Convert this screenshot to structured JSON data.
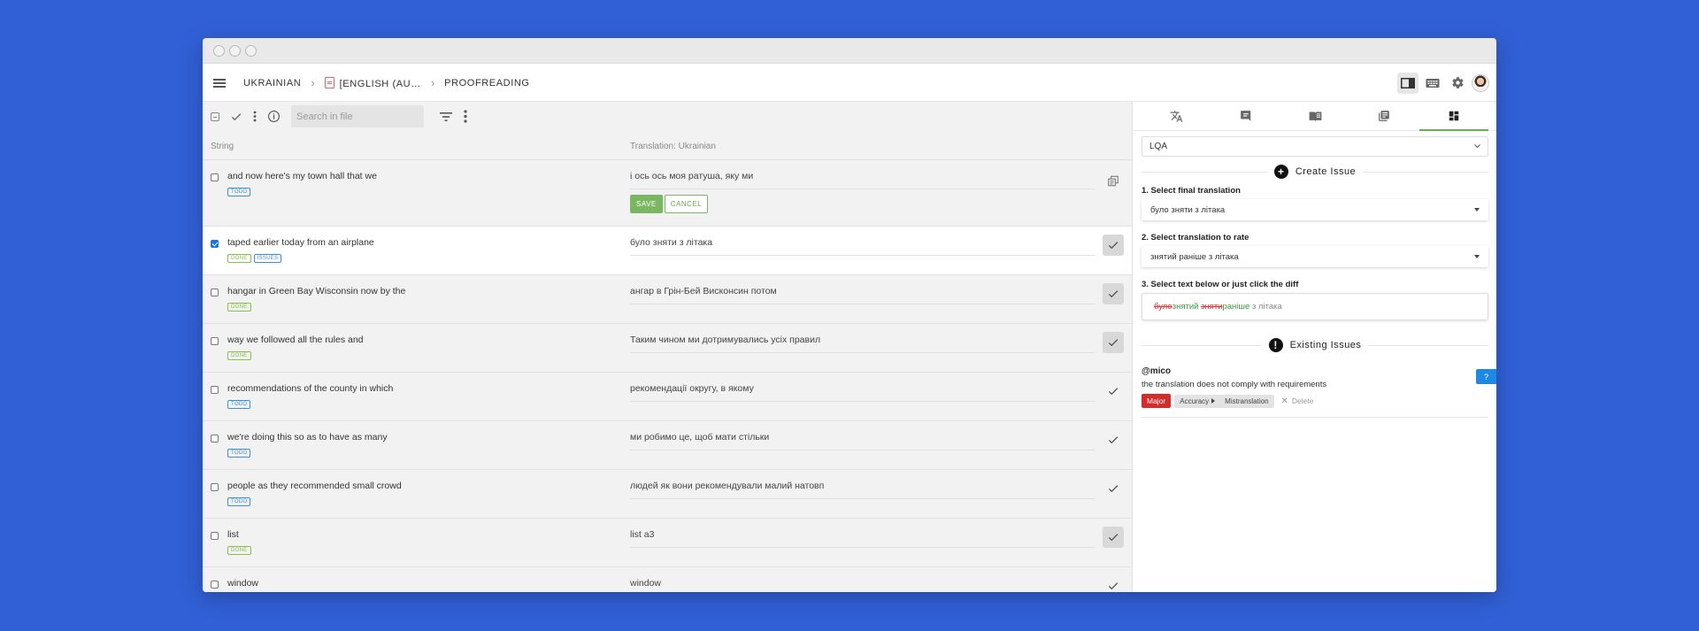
{
  "breadcrumb": {
    "project": "UKRAINIAN",
    "file": "[ENGLISH (AU…",
    "step": "PROOFREADING"
  },
  "toolbar": {
    "search_placeholder": "Search in file"
  },
  "columns": {
    "string": "String",
    "translation": "Translation: Ukrainian"
  },
  "rows": [
    {
      "source": "and now here's my town hall that we",
      "translation": "і ось ось моя ратуша, яку ми",
      "tags": [
        "TODO"
      ],
      "checked": false,
      "editing": true
    },
    {
      "source": "taped earlier today from an airplane",
      "translation": "було зняти з літака",
      "tags": [
        "DONE",
        "ISSUES"
      ],
      "checked": true,
      "approved": true
    },
    {
      "source": "hangar in Green Bay Wisconsin now by the",
      "translation": "ангар в Грін-Бей Висконсин потом",
      "tags": [
        "DONE"
      ],
      "checked": false,
      "approved": true
    },
    {
      "source": "way we followed all the rules and",
      "translation": "Таким чином ми дотримувались усіх правил",
      "tags": [
        "DONE"
      ],
      "checked": false,
      "approved": true
    },
    {
      "source": "recommendations of the county in which",
      "translation": "рекомендації округу, в якому",
      "tags": [
        "TODO"
      ],
      "checked": false,
      "approved": false
    },
    {
      "source": "we're doing this so as to have as many",
      "translation": "ми робимо це, щоб мати стільки",
      "tags": [
        "TODO"
      ],
      "checked": false,
      "approved": false
    },
    {
      "source": "people as they recommended small crowd",
      "translation": "людей як вони рекомендували малий натовп",
      "tags": [
        "TODO"
      ],
      "checked": false,
      "approved": false
    },
    {
      "source": "list",
      "translation": "list a3",
      "tags": [
        "DONE"
      ],
      "checked": false,
      "approved": true
    },
    {
      "source": "window",
      "translation": "window",
      "tags": [
        "TODO"
      ],
      "checked": false,
      "approved": false
    }
  ],
  "edit": {
    "save": "SAVE",
    "cancel": "CANCEL"
  },
  "panel": {
    "mode": "LQA",
    "create_issue": "Create Issue",
    "step1_label": "1. Select final translation",
    "step1_value": "було зняти з літака",
    "step2_label": "2. Select translation to rate",
    "step2_value": "знятий раніше з літака",
    "step3_label": "3. Select text below or just click the diff",
    "diff": {
      "del1": "було",
      "ins1": "знятий",
      "space": " ",
      "del2": "зняти",
      "ins2": "раніше",
      "rest": " з літака"
    },
    "existing_issues": "Existing Issues",
    "issue": {
      "user": "@mico",
      "text": "the translation does not comply with requirements",
      "severity": "Major",
      "category": "Accuracy",
      "subcategory": "Mistranslation",
      "delete": "Delete",
      "help": "?"
    }
  },
  "colors": {
    "background": "#3160d6",
    "accent_green": "#6ab04c",
    "todo_blue": "#3d8fd8",
    "done_green": "#8bbf4a",
    "major_red": "#d62b2b",
    "help_blue": "#1e88e5"
  }
}
